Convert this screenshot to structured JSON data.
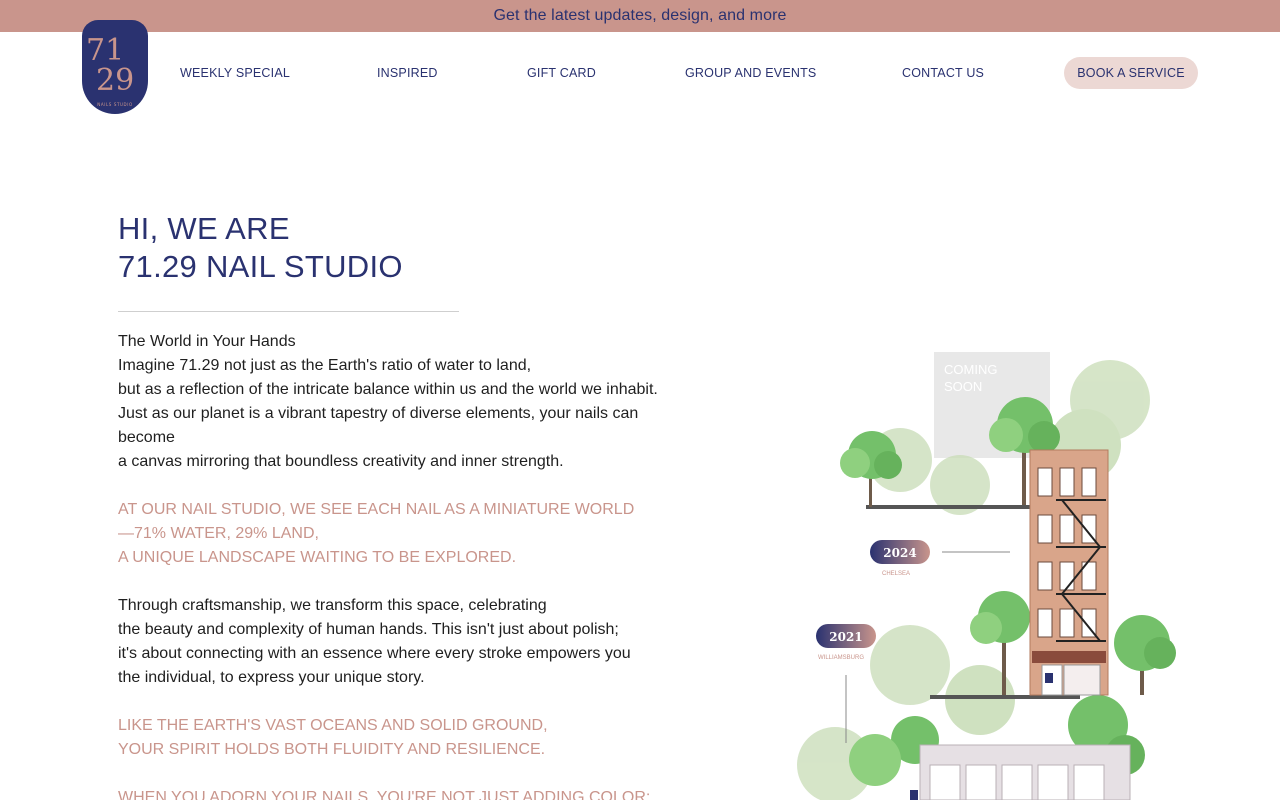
{
  "announcement": "Get the latest updates, design, and more",
  "logo": {
    "top_digits": "71",
    "bottom_digits": "29",
    "caption": "NAILS STUDIO"
  },
  "nav": [
    {
      "id": "weekly-special",
      "label": "WEEKLY SPECIAL"
    },
    {
      "id": "inspired",
      "label": "INSPIRED"
    },
    {
      "id": "gift-card",
      "label": "GIFT CARD"
    },
    {
      "id": "group-events",
      "label": "GROUP AND EVENTS"
    },
    {
      "id": "contact",
      "label": "CONTACT US"
    }
  ],
  "book_label": "BOOK A SERVICE",
  "hero": {
    "line1": "HI, WE ARE",
    "line2": "71.29 NAIL STUDIO"
  },
  "intro": [
    "The World in Your Hands",
    "Imagine 71.29 not just as the Earth's ratio of water to land,",
    "but as a reflection of the intricate balance within us and the world we inhabit.",
    "Just as our planet is a vibrant tapestry of diverse elements, your nails can",
    "become",
    "a canvas mirroring that boundless creativity and inner strength."
  ],
  "highlight1": [
    "AT OUR NAIL STUDIO, WE SEE EACH NAIL AS A MINIATURE WORLD",
    "—71% WATER, 29% LAND,",
    "A UNIQUE LANDSCAPE WAITING TO BE EXPLORED."
  ],
  "craft": [
    "Through craftsmanship, we transform this space, celebrating",
    "the beauty and complexity of human hands. This isn't just about polish;",
    "it's about connecting with an essence where every stroke empowers you",
    "the individual, to express your unique story."
  ],
  "highlight2": [
    "LIKE THE EARTH'S VAST OCEANS AND SOLID GROUND,",
    "YOUR SPIRIT HOLDS BOTH FLUIDITY AND RESILIENCE."
  ],
  "highlight3": "WHEN YOU ADORN YOUR NAILS, YOU'RE NOT JUST ADDING COLOR;",
  "illustration": {
    "coming_soon_1": "COMING",
    "coming_soon_2": "SOON",
    "badge_2024": "2024",
    "caption_2024": "CHELSEA",
    "badge_2021": "2021",
    "caption_2021": "WILLIAMSBURG"
  },
  "colors": {
    "navy": "#2a3270",
    "rose": "#c9958c",
    "blush": "#ecd8d4"
  }
}
